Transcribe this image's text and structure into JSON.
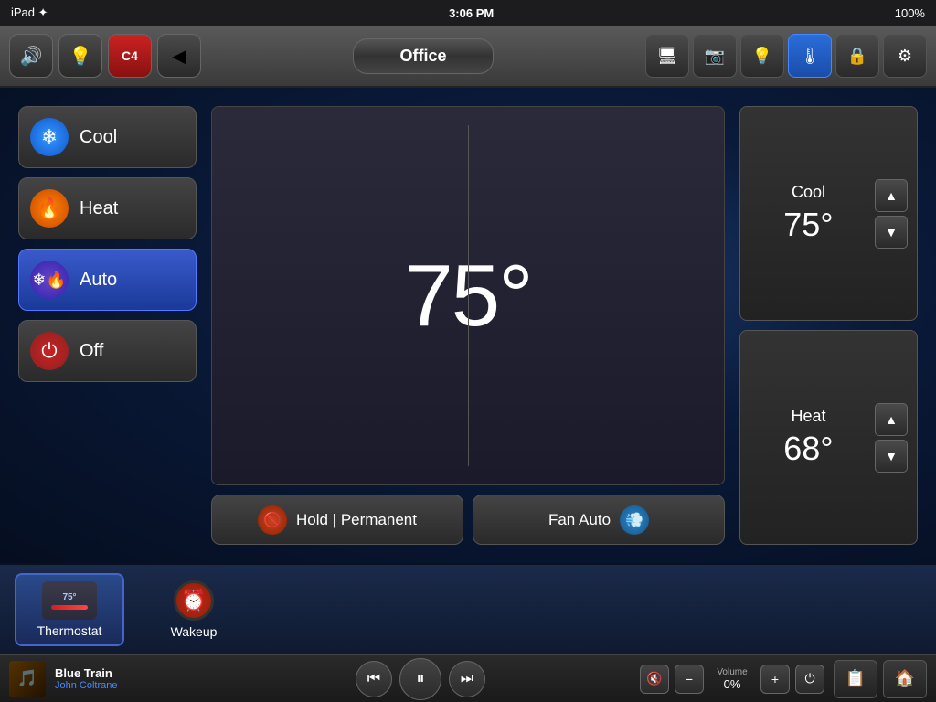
{
  "statusBar": {
    "left": "iPad ✦",
    "time": "3:06 PM",
    "battery": "100%"
  },
  "topBar": {
    "title": "Office",
    "buttons": [
      {
        "id": "speaker",
        "icon": "🔊"
      },
      {
        "id": "light",
        "icon": "💡"
      },
      {
        "id": "crestron",
        "icon": "🔴"
      },
      {
        "id": "back",
        "icon": "◀"
      }
    ],
    "navIcons": [
      {
        "id": "display",
        "icon": "🖥"
      },
      {
        "id": "camera",
        "icon": "📷"
      },
      {
        "id": "light2",
        "icon": "💡"
      },
      {
        "id": "thermostat",
        "icon": "🌡",
        "active": true
      },
      {
        "id": "lock",
        "icon": "🔒"
      },
      {
        "id": "settings",
        "icon": "⚙"
      }
    ]
  },
  "thermostat": {
    "currentTemp": "75°",
    "modes": [
      {
        "id": "cool",
        "label": "Cool",
        "iconSymbol": "❄",
        "active": false
      },
      {
        "id": "heat",
        "label": "Heat",
        "iconSymbol": "🔥",
        "active": false
      },
      {
        "id": "auto",
        "label": "Auto",
        "iconSymbol": "❄",
        "active": true
      },
      {
        "id": "off",
        "label": "Off",
        "iconSymbol": "⏻",
        "active": false
      }
    ],
    "holdLabel": "Hold | Permanent",
    "fanLabel": "Fan Auto",
    "cool": {
      "label": "Cool",
      "temp": "75°"
    },
    "heat": {
      "label": "Heat",
      "temp": "68°"
    }
  },
  "bottomPanel": {
    "items": [
      {
        "id": "thermostat-item",
        "label": "Thermostat",
        "selected": true,
        "temp": "75°"
      },
      {
        "id": "wakeup-item",
        "label": "Wakeup",
        "selected": false
      }
    ]
  },
  "mediaBar": {
    "albumArt": "🎵",
    "trackTitle": "Blue Train",
    "trackArtist": "John Coltrane",
    "volumeLabel": "Volume",
    "volumeValue": "0%",
    "buttons": {
      "prev": "⏮",
      "play": "⏸",
      "next": "⏭",
      "mute": "🔇",
      "volDown": "−",
      "volUp": "+",
      "power": "⏻"
    },
    "footerActions": [
      "📋",
      "🏠"
    ]
  }
}
